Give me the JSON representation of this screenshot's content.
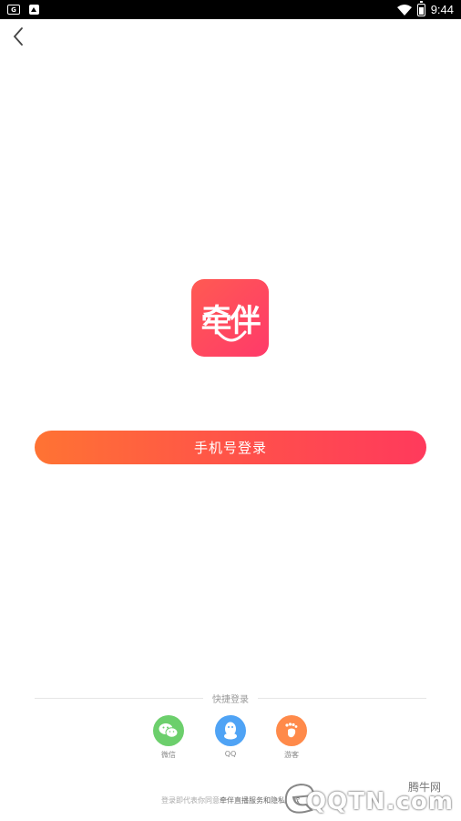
{
  "status_bar": {
    "time": "9:44"
  },
  "logo": {
    "text": "牵伴"
  },
  "login": {
    "phone_button_label": "手机号登录"
  },
  "quick_login": {
    "title": "快捷登录",
    "options": [
      {
        "label": "微信",
        "icon": "wechat-icon",
        "color": "#6ccf6c"
      },
      {
        "label": "QQ",
        "icon": "qq-penguin-icon",
        "color": "#4fa3f5"
      },
      {
        "label": "游客",
        "icon": "footprint-icon",
        "color": "#ff8a4a"
      }
    ]
  },
  "agreement": {
    "prefix": "登录即代表你同意",
    "link": "牵伴直播服务和隐私条款"
  },
  "watermark": {
    "brand": "QQTN.com",
    "cn": "腾牛网"
  }
}
